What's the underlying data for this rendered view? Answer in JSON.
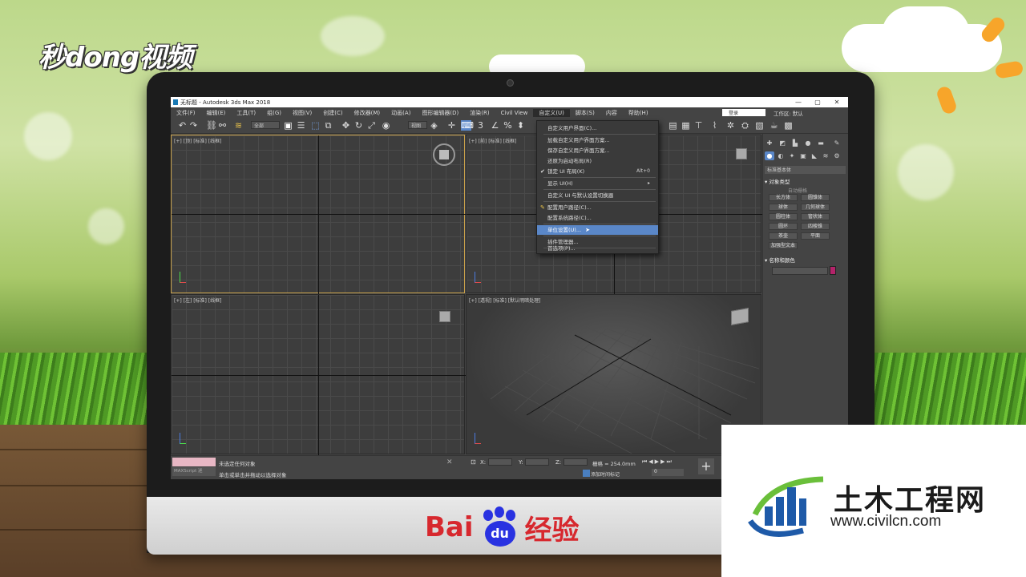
{
  "brand_logo": "秒dong视频",
  "window": {
    "title": "无标题 - Autodesk 3ds Max 2018",
    "controls": [
      "—",
      "▢",
      "✕"
    ]
  },
  "menubar": [
    "文件(F)",
    "编辑(E)",
    "工具(T)",
    "组(G)",
    "视图(V)",
    "创建(C)",
    "修改器(M)",
    "动画(A)",
    "图形编辑器(D)",
    "渲染(R)",
    "Civil View",
    "自定义(U)",
    "脚本(S)",
    "内容",
    "帮助(H)"
  ],
  "login": "登录",
  "workspace": "工作区: 默认",
  "toolbar": {
    "selection_filter": "全部",
    "view_select": "视图"
  },
  "viewports": [
    {
      "label": "[+] [顶] [标准] [线框]"
    },
    {
      "label": "[+] [前] [标准] [线框]"
    },
    {
      "label": "[+] [左] [标准] [线框]"
    },
    {
      "label": "[+] [透视] [标准] [默认明暗处理]"
    }
  ],
  "customize_menu": {
    "items": [
      {
        "label": "自定义用户界面(C)...",
        "shortcut": "",
        "checked": false
      },
      {
        "label": "加载自定义用户界面方案...",
        "shortcut": "",
        "checked": false
      },
      {
        "label": "保存自定义用户界面方案...",
        "shortcut": "",
        "checked": false
      },
      {
        "label": "还原为启动布局(R)",
        "shortcut": "",
        "checked": false
      },
      {
        "label": "锁定 UI 布局(K)",
        "shortcut": "Alt+0",
        "checked": true
      },
      {
        "label": "显示 UI(H)",
        "shortcut": "▸",
        "checked": false
      },
      {
        "label": "自定义 UI 与默认设置切换器",
        "shortcut": "",
        "checked": false
      },
      {
        "label": "配置用户路径(C)...",
        "shortcut": "",
        "checked": false
      },
      {
        "label": "配置系统路径(C)...",
        "shortcut": "",
        "checked": false
      },
      {
        "label": "单位设置(U)...",
        "shortcut": "",
        "checked": false,
        "highlighted": true
      },
      {
        "label": "插件管理器...",
        "shortcut": "",
        "checked": false
      },
      {
        "label": "首选项(P)...",
        "shortcut": "",
        "checked": false
      }
    ]
  },
  "command_panel": {
    "category": "标准基本体",
    "object_type_header": "对象类型",
    "autogrid": "自动栅格",
    "buttons": [
      "长方体",
      "圆锥体",
      "球体",
      "几何球体",
      "圆柱体",
      "管状体",
      "圆环",
      "四棱锥",
      "茶壶",
      "平面",
      "加强型文本"
    ],
    "name_color_header": "名称和颜色",
    "color": "#b4236a"
  },
  "status_bar": {
    "maxscript": "MAXScript 迷",
    "line1": "未选定任何对象",
    "line2": "单击或单击并拖动以选择对象",
    "x_label": "X:",
    "y_label": "Y:",
    "z_label": "Z:",
    "grid": "栅格 = 254.0mm",
    "add_time_tag": "添加时间标记",
    "frame": "0"
  },
  "watermark": {
    "title": "土木工程网",
    "url": "www.civilcn.com"
  },
  "monitor_brand": {
    "prefix": "Bai",
    "paw_text": "du",
    "suffix": "经验"
  }
}
